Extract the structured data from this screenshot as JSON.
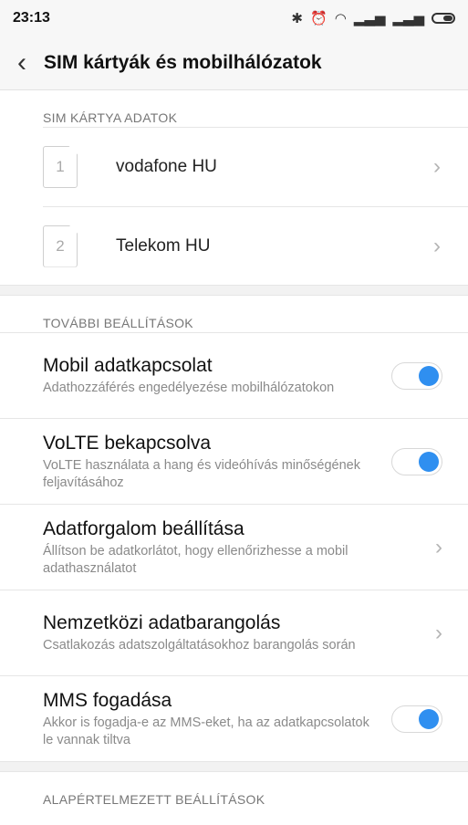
{
  "status": {
    "time": "23:13"
  },
  "header": {
    "title": "SIM kártyák és mobilhálózatok"
  },
  "sim_section": {
    "title": "SIM KÁRTYA ADATOK",
    "cards": [
      {
        "slot": "1",
        "name": "vodafone HU"
      },
      {
        "slot": "2",
        "name": "Telekom HU"
      }
    ]
  },
  "more_section": {
    "title": "TOVÁBBI BEÁLLÍTÁSOK",
    "items": [
      {
        "title": "Mobil adatkapcsolat",
        "subtitle": "Adathozzáférés engedélyezése mobilhálózatokon",
        "type": "toggle",
        "on": true
      },
      {
        "title": "VoLTE bekapcsolva",
        "subtitle": "VoLTE használata a hang és videóhívás minőségének feljavításához",
        "type": "toggle",
        "on": true
      },
      {
        "title": "Adatforgalom beállítása",
        "subtitle": "Állítson be adatkorlátot, hogy ellenőrizhesse a mobil adathasználatot",
        "type": "link"
      },
      {
        "title": "Nemzetközi adatbarangolás",
        "subtitle": "Csatlakozás adatszolgáltatásokhoz barangolás során",
        "type": "link"
      },
      {
        "title": "MMS fogadása",
        "subtitle": "Akkor is fogadja-e az MMS-eket, ha az adatkapcsolatok le vannak tiltva",
        "type": "toggle",
        "on": true
      }
    ]
  },
  "default_section": {
    "title": "ALAPÉRTELMEZETT BEÁLLÍTÁSOK"
  },
  "colors": {
    "accent": "#2f8ff0"
  },
  "icons": {
    "back": "back-arrow-icon",
    "chevron": "chevron-right-icon"
  }
}
